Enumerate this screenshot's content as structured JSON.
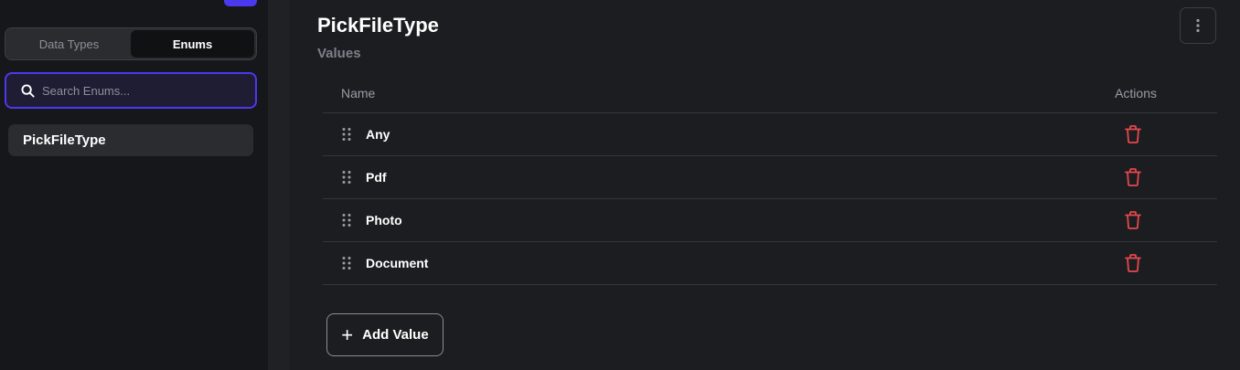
{
  "sidebar": {
    "tabs": [
      {
        "label": "Data Types",
        "active": false
      },
      {
        "label": "Enums",
        "active": true
      }
    ],
    "search": {
      "placeholder": "Search Enums...",
      "value": ""
    },
    "items": [
      {
        "label": "PickFileType",
        "selected": true
      }
    ]
  },
  "main": {
    "title": "PickFileType",
    "subtitle": "Values",
    "table": {
      "headers": {
        "name": "Name",
        "actions": "Actions"
      },
      "rows": [
        {
          "label": "Any"
        },
        {
          "label": "Pdf"
        },
        {
          "label": "Photo"
        },
        {
          "label": "Document"
        }
      ]
    },
    "add_button": {
      "icon": "+",
      "label": "Add Value"
    }
  },
  "icons": {
    "search": "search-icon",
    "more": "more-vertical-icon",
    "drag": "drag-handle-icon",
    "delete": "trash-icon",
    "add": "plus-icon"
  },
  "colors": {
    "accent": "#4b39ef",
    "danger": "#e5484d",
    "background": "#1c1d20",
    "sidebar": "#16171a"
  }
}
